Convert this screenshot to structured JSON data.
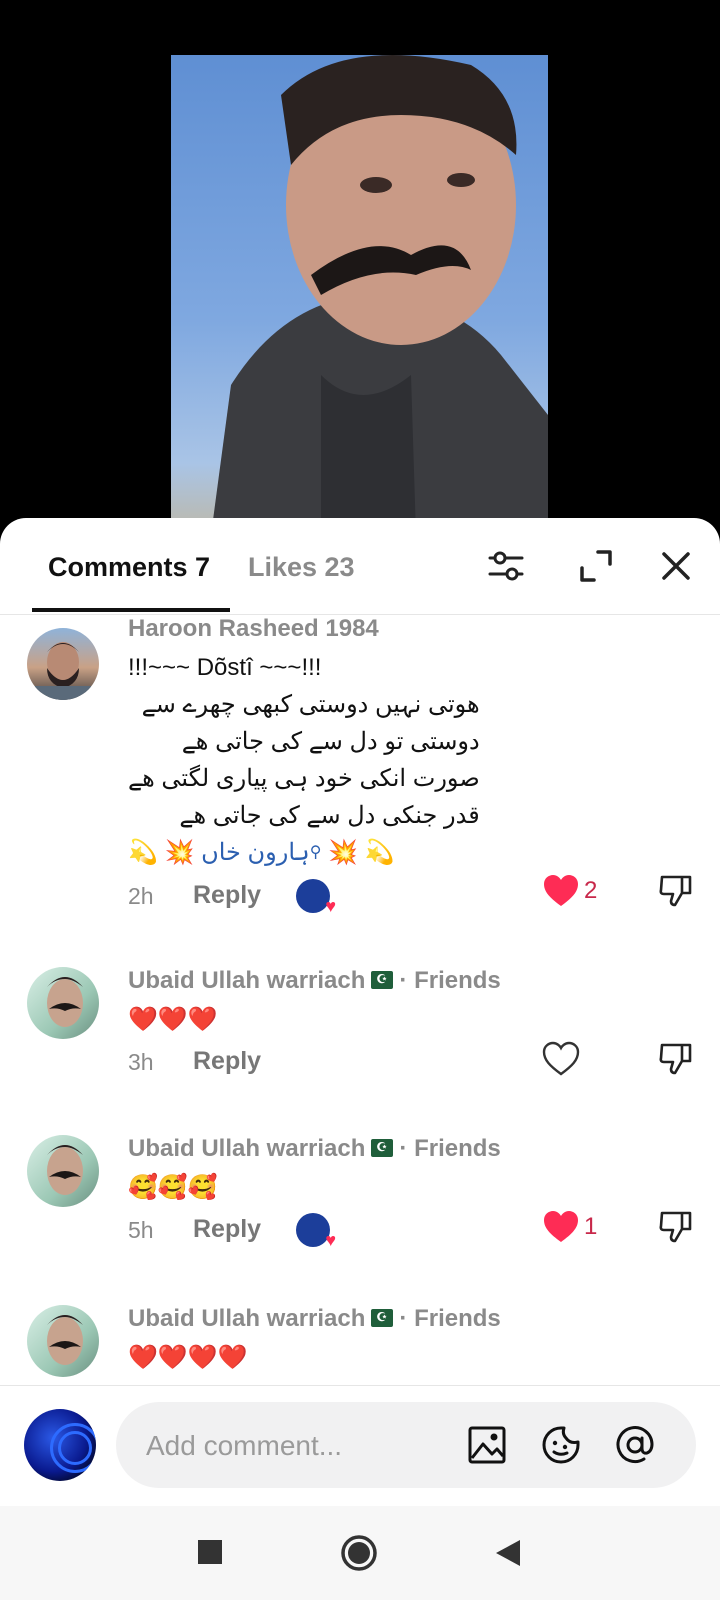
{
  "tabs": {
    "comments_label": "Comments 7",
    "likes_label": "Likes 23"
  },
  "header_icons": [
    "filter-icon",
    "expand-icon",
    "close-icon"
  ],
  "comments": [
    {
      "author": "Haroon Rasheed 1984",
      "lines": [
        "!!!~~~ Dõstî ~~~!!!",
        "ھوتی نہیں دوستی کبھی چھرے سے",
        "دوستی تو دل سے کی جاتی ھے",
        "صورت انکی خود ہی پیاری لگتی ھے",
        "قدر جنکی دل سے کی جاتی ھے"
      ],
      "mention": "ہارون خاں",
      "time": "2h",
      "reply_label": "Reply",
      "liked": true,
      "like_count": "2",
      "creator_liked": true
    },
    {
      "author": "Ubaid Ullah warriach",
      "suffix": "· Friends",
      "body": "❤️❤️❤️",
      "time": "3h",
      "reply_label": "Reply",
      "liked": false,
      "like_count": "",
      "creator_liked": false
    },
    {
      "author": "Ubaid Ullah warriach",
      "suffix": "· Friends",
      "body": "🥰🥰🥰",
      "time": "5h",
      "reply_label": "Reply",
      "liked": true,
      "like_count": "1",
      "creator_liked": true
    },
    {
      "author": "Ubaid Ullah warriach",
      "suffix": "· Friends",
      "body": "❤️❤️❤️❤️"
    }
  ],
  "input": {
    "placeholder": "Add comment..."
  },
  "colors": {
    "like_red": "#fe2c55",
    "text_primary": "#111111",
    "text_secondary": "#8a8a8a"
  }
}
